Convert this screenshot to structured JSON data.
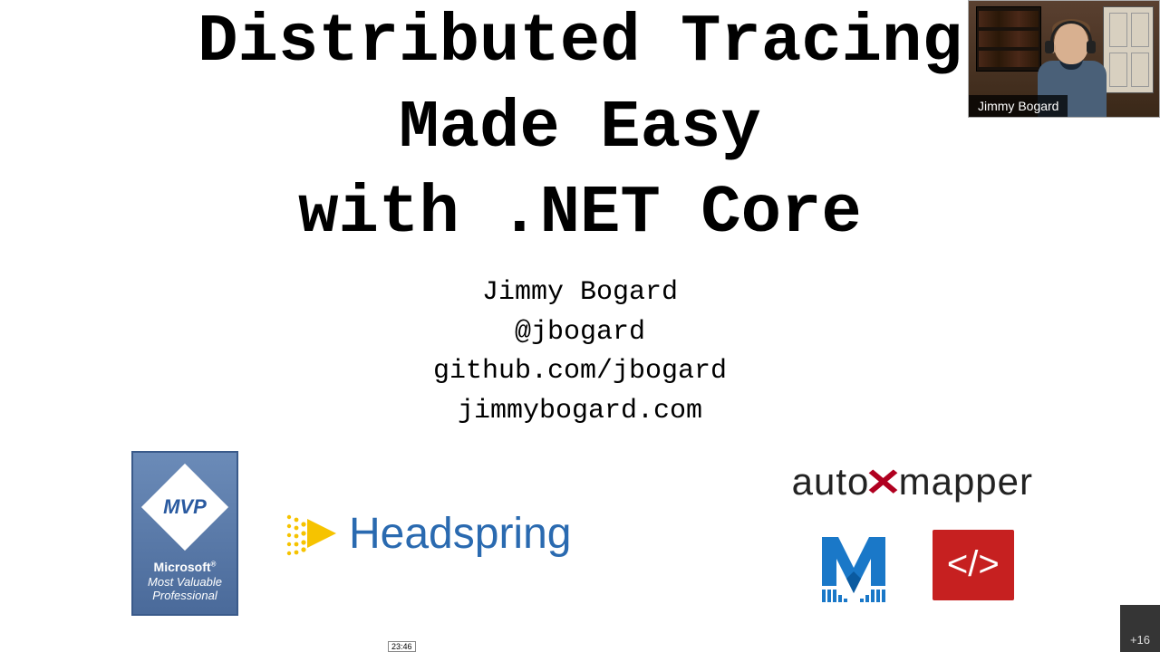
{
  "slide": {
    "title_line1": "Distributed Tracing",
    "title_line2": "Made Easy",
    "title_line3": "with .NET Core",
    "author": "Jimmy Bogard",
    "twitter": "@jbogard",
    "github": "github.com/jbogard",
    "website": "jimmybogard.com"
  },
  "logos": {
    "mvp": {
      "abbr": "MVP",
      "line1": "Microsoft",
      "line2": "Most Valuable",
      "line3": "Professional"
    },
    "headspring": "Headspring",
    "automapper_left": "auto",
    "automapper_right": "mapper",
    "code_symbol": "</>"
  },
  "webcam": {
    "label": "Jimmy Bogard"
  },
  "timestamp": "23:46",
  "participant_count": "+16"
}
